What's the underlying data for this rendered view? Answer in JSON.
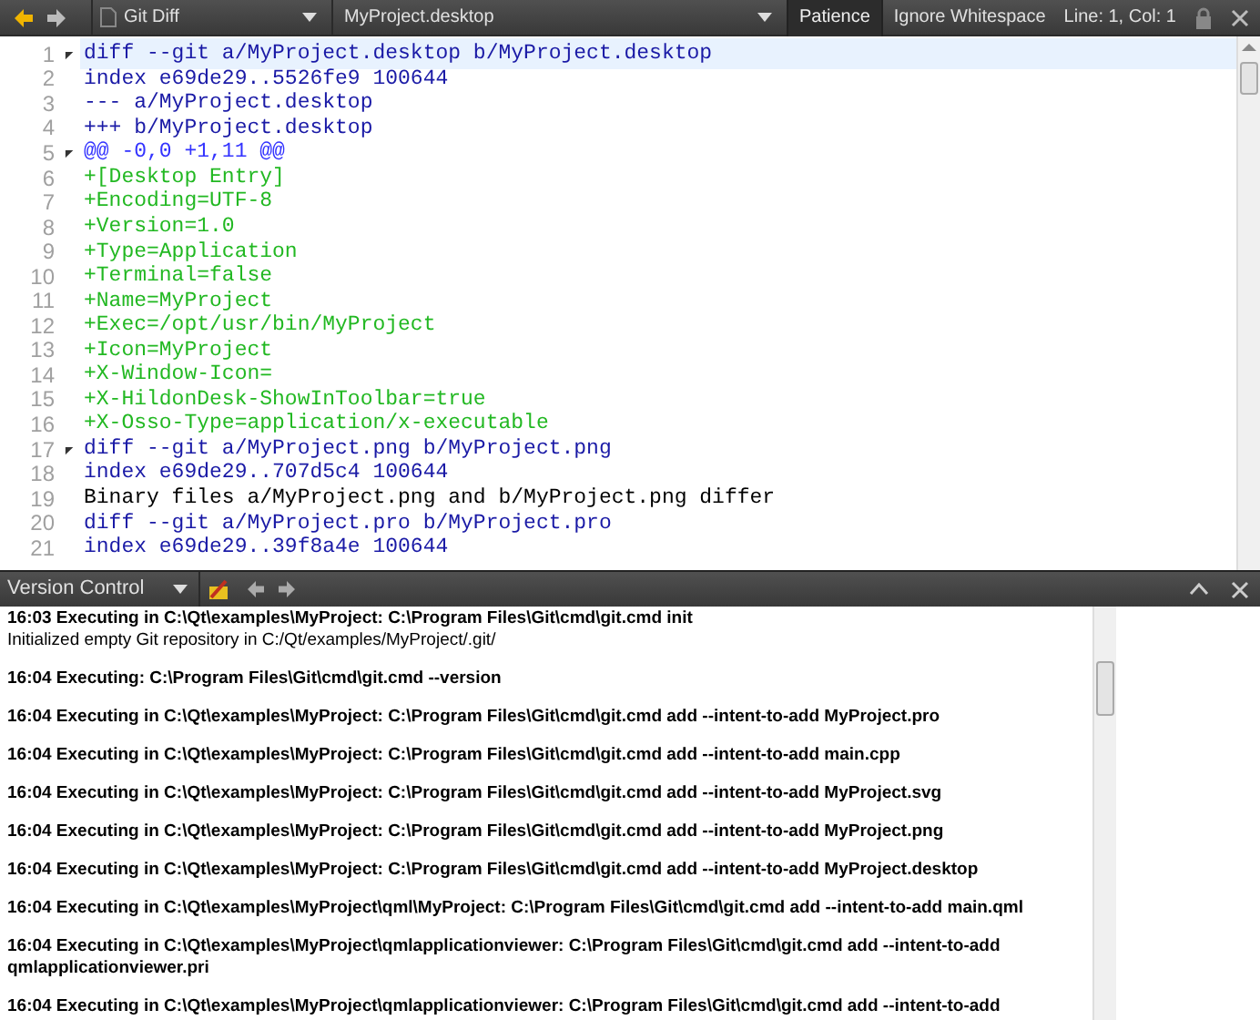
{
  "toolbar": {
    "editor_type": "Git Diff",
    "file": "MyProject.desktop",
    "buttons": [
      {
        "label": "Patience",
        "selected": true
      },
      {
        "label": "Ignore Whitespace",
        "selected": false
      }
    ],
    "position": "Line: 1, Col: 1"
  },
  "editor": {
    "lines": [
      {
        "number": "1",
        "kind": "header",
        "text": "diff --git a/MyProject.desktop b/MyProject.desktop",
        "fold": true,
        "current": true
      },
      {
        "number": "2",
        "kind": "header",
        "text": "index e69de29..5526fe9 100644",
        "fold": false,
        "current": false
      },
      {
        "number": "3",
        "kind": "header",
        "text": "--- a/MyProject.desktop",
        "fold": false,
        "current": false
      },
      {
        "number": "4",
        "kind": "header",
        "text": "+++ b/MyProject.desktop",
        "fold": false,
        "current": false
      },
      {
        "number": "5",
        "kind": "hunk",
        "text": "@@ -0,0 +1,11 @@",
        "fold": true,
        "current": false
      },
      {
        "number": "6",
        "kind": "added",
        "text": "+[Desktop Entry]",
        "fold": false,
        "current": false
      },
      {
        "number": "7",
        "kind": "added",
        "text": "+Encoding=UTF-8",
        "fold": false,
        "current": false
      },
      {
        "number": "8",
        "kind": "added",
        "text": "+Version=1.0",
        "fold": false,
        "current": false
      },
      {
        "number": "9",
        "kind": "added",
        "text": "+Type=Application",
        "fold": false,
        "current": false
      },
      {
        "number": "10",
        "kind": "added",
        "text": "+Terminal=false",
        "fold": false,
        "current": false
      },
      {
        "number": "11",
        "kind": "added",
        "text": "+Name=MyProject",
        "fold": false,
        "current": false
      },
      {
        "number": "12",
        "kind": "added",
        "text": "+Exec=/opt/usr/bin/MyProject",
        "fold": false,
        "current": false
      },
      {
        "number": "13",
        "kind": "added",
        "text": "+Icon=MyProject",
        "fold": false,
        "current": false
      },
      {
        "number": "14",
        "kind": "added",
        "text": "+X-Window-Icon=",
        "fold": false,
        "current": false
      },
      {
        "number": "15",
        "kind": "added",
        "text": "+X-HildonDesk-ShowInToolbar=true",
        "fold": false,
        "current": false
      },
      {
        "number": "16",
        "kind": "added",
        "text": "+X-Osso-Type=application/x-executable",
        "fold": false,
        "current": false
      },
      {
        "number": "17",
        "kind": "header",
        "text": "diff --git a/MyProject.png b/MyProject.png",
        "fold": true,
        "current": false
      },
      {
        "number": "18",
        "kind": "header",
        "text": "index e69de29..707d5c4 100644",
        "fold": false,
        "current": false
      },
      {
        "number": "19",
        "kind": "plain",
        "text": "Binary files a/MyProject.png and b/MyProject.png differ",
        "fold": false,
        "current": false
      },
      {
        "number": "20",
        "kind": "header",
        "text": "diff --git a/MyProject.pro b/MyProject.pro",
        "fold": false,
        "current": false
      },
      {
        "number": "21",
        "kind": "header",
        "text": "index e69de29..39f8a4e 100644",
        "fold": false,
        "current": false
      }
    ]
  },
  "output_pane": {
    "title": "Version Control",
    "entries": [
      {
        "command": "16:03 Executing in C:\\Qt\\examples\\MyProject: C:\\Program Files\\Git\\cmd\\git.cmd init",
        "output": "Initialized empty Git repository in C:/Qt/examples/MyProject/.git/"
      },
      {
        "command": "16:04 Executing: C:\\Program Files\\Git\\cmd\\git.cmd --version"
      },
      {
        "command": "16:04 Executing in C:\\Qt\\examples\\MyProject: C:\\Program Files\\Git\\cmd\\git.cmd add --intent-to-add MyProject.pro"
      },
      {
        "command": "16:04 Executing in C:\\Qt\\examples\\MyProject: C:\\Program Files\\Git\\cmd\\git.cmd add --intent-to-add main.cpp"
      },
      {
        "command": "16:04 Executing in C:\\Qt\\examples\\MyProject: C:\\Program Files\\Git\\cmd\\git.cmd add --intent-to-add MyProject.svg"
      },
      {
        "command": "16:04 Executing in C:\\Qt\\examples\\MyProject: C:\\Program Files\\Git\\cmd\\git.cmd add --intent-to-add MyProject.png"
      },
      {
        "command": "16:04 Executing in C:\\Qt\\examples\\MyProject: C:\\Program Files\\Git\\cmd\\git.cmd add --intent-to-add MyProject.desktop"
      },
      {
        "command": "16:04 Executing in C:\\Qt\\examples\\MyProject\\qml\\MyProject: C:\\Program Files\\Git\\cmd\\git.cmd add --intent-to-add main.qml"
      },
      {
        "command": "16:04 Executing in C:\\Qt\\examples\\MyProject\\qmlapplicationviewer: C:\\Program Files\\Git\\cmd\\git.cmd add --intent-to-add qmlapplicationviewer.pri"
      },
      {
        "command": "16:04 Executing in C:\\Qt\\examples\\MyProject\\qmlapplicationviewer: C:\\Program Files\\Git\\cmd\\git.cmd add --intent-to-add"
      }
    ]
  }
}
